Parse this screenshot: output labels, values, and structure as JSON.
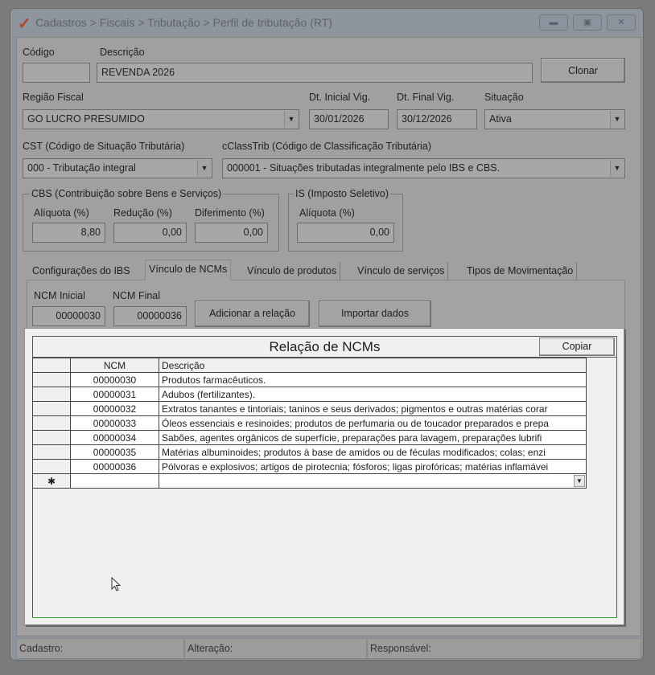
{
  "window": {
    "breadcrumb": "Cadastros > Fiscais > Tributação > Perfil de tributação (RT)",
    "logo": "✓",
    "controls": [
      "minimize",
      "maximize",
      "close"
    ]
  },
  "form": {
    "codigo_label": "Código",
    "codigo_value": "",
    "descricao_label": "Descrição",
    "descricao_value": "REVENDA 2026",
    "clonar": "Clonar",
    "regiao_label": "Região Fiscal",
    "regiao_value": "GO LUCRO PRESUMIDO",
    "dt_inicial_label": "Dt. Inicial Vig.",
    "dt_inicial_value": "30/01/2026",
    "dt_final_label": "Dt. Final Vig.",
    "dt_final_value": "30/12/2026",
    "situacao_label": "Situação",
    "situacao_value": "Ativa",
    "cst_label": "CST (Código de Situação Tributária)",
    "cst_value": "000 - Tributação integral",
    "cclass_label": "cClassTrib (Código de Classificação Tributária)",
    "cclass_value": "000001 - Situações tributadas integralmente pelo IBS e CBS."
  },
  "cbs": {
    "title": "CBS (Contribuição sobre Bens e Serviços)",
    "aliquota_label": "Alíquota (%)",
    "aliquota": "8,80",
    "reducao_label": "Redução (%)",
    "reducao": "0,00",
    "diferimento_label": "Diferimento (%)",
    "diferimento": "0,00"
  },
  "is": {
    "title": "IS (Imposto Seletivo)",
    "aliquota_label": "Alíquota (%)",
    "aliquota": "0,00"
  },
  "tabs": [
    {
      "label": "Configurações do IBS"
    },
    {
      "label": "Vínculo de NCMs",
      "active": true
    },
    {
      "label": "Vínculo de produtos"
    },
    {
      "label": "Vínculo de serviços"
    },
    {
      "label": "Tipos de Movimentação"
    }
  ],
  "ncm_tab": {
    "inicial_label": "NCM Inicial",
    "inicial": "00000030",
    "final_label": "NCM Final",
    "final": "00000036",
    "adicionar": "Adicionar a relação",
    "importar": "Importar dados"
  },
  "grid": {
    "title": "Relação de NCMs",
    "copiar": "Copiar",
    "columns": [
      "NCM",
      "Descrição"
    ],
    "new_row_marker": "✱",
    "rows": [
      {
        "ncm": "00000030",
        "desc": "Produtos farmacêuticos."
      },
      {
        "ncm": "00000031",
        "desc": "Adubos (fertilizantes)."
      },
      {
        "ncm": "00000032",
        "desc": "Extratos tanantes e tintoriais; taninos e seus derivados; pigmentos e outras matérias corar"
      },
      {
        "ncm": "00000033",
        "desc": "Óleos essenciais e resinoides; produtos de perfumaria ou de toucador preparados e prepa"
      },
      {
        "ncm": "00000034",
        "desc": "Sabões, agentes orgânicos de superfície, preparações para lavagem, preparações lubrifi"
      },
      {
        "ncm": "00000035",
        "desc": "Matérias albuminoides; produtos à base de amidos ou de féculas modificados; colas; enzi"
      },
      {
        "ncm": "00000036",
        "desc": "Pólvoras e explosivos; artigos de pirotecnia; fósforos; ligas pirofóricas; matérias inflamávei"
      }
    ]
  },
  "status": {
    "cadastro": "Cadastro:",
    "alteracao": "Alteração:",
    "responsavel": "Responsável:"
  },
  "colors": {
    "highlight_panel": "#f0f0f0",
    "dimmed_bg": "#a0a0a0",
    "logo": "#b0462a"
  }
}
